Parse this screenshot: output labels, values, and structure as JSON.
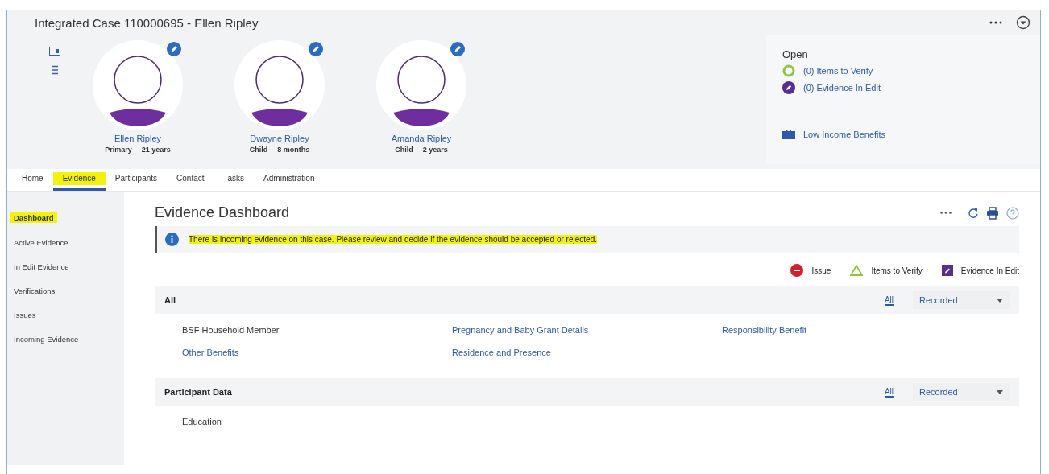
{
  "window": {
    "title": "Integrated Case 110000695 - Ellen Ripley"
  },
  "participants": [
    {
      "name": "Ellen Ripley",
      "role": "Primary",
      "age": "21 years"
    },
    {
      "name": "Dwayne Ripley",
      "role": "Child",
      "age": "8 months"
    },
    {
      "name": "Amanda Ripley",
      "role": "Child",
      "age": "2 years"
    }
  ],
  "open_panel": {
    "title": "Open",
    "items": [
      {
        "label": "(0) Items to Verify",
        "kind": "verify"
      },
      {
        "label": "(0) Evidence In Edit",
        "kind": "edit"
      }
    ],
    "program": "Low Income Benefits"
  },
  "tabs": [
    {
      "label": "Home",
      "selected": false,
      "highlighted": false
    },
    {
      "label": "Evidence",
      "selected": true,
      "highlighted": true
    },
    {
      "label": "Participants",
      "selected": false,
      "highlighted": false
    },
    {
      "label": "Contact",
      "selected": false,
      "highlighted": false
    },
    {
      "label": "Tasks",
      "selected": false,
      "highlighted": false
    },
    {
      "label": "Administration",
      "selected": false,
      "highlighted": false
    }
  ],
  "sidebar": {
    "items": [
      {
        "label": "Dashboard",
        "selected": true,
        "highlighted": true
      },
      {
        "label": "Active Evidence",
        "selected": false,
        "highlighted": false
      },
      {
        "label": "In Edit Evidence",
        "selected": false,
        "highlighted": false
      },
      {
        "label": "Verifications",
        "selected": false,
        "highlighted": false
      },
      {
        "label": "Issues",
        "selected": false,
        "highlighted": false
      },
      {
        "label": "Incoming Evidence",
        "selected": false,
        "highlighted": false
      }
    ]
  },
  "page": {
    "title": "Evidence Dashboard",
    "message": {
      "text": "There is incoming evidence on this case. Please review and decide if the evidence should be accepted or rejected.",
      "highlighted": true
    },
    "legend": [
      {
        "label": "Issue",
        "kind": "issue"
      },
      {
        "label": "Items to Verify",
        "kind": "verify"
      },
      {
        "label": "Evidence In Edit",
        "kind": "edit"
      }
    ],
    "sections": [
      {
        "title": "All",
        "filter_link": "All",
        "filter_value": "Recorded",
        "items": [
          {
            "label": "BSF Household Member",
            "kind": "text"
          },
          {
            "label": "Pregnancy and Baby Grant Details",
            "kind": "link"
          },
          {
            "label": "Responsibility Benefit",
            "kind": "link"
          },
          {
            "label": "Other Benefits",
            "kind": "link"
          },
          {
            "label": "Residence and Presence",
            "kind": "link"
          }
        ]
      },
      {
        "title": "Participant Data",
        "filter_link": "All",
        "filter_value": "Recorded",
        "items": [
          {
            "label": "Education",
            "kind": "text"
          }
        ]
      }
    ]
  }
}
